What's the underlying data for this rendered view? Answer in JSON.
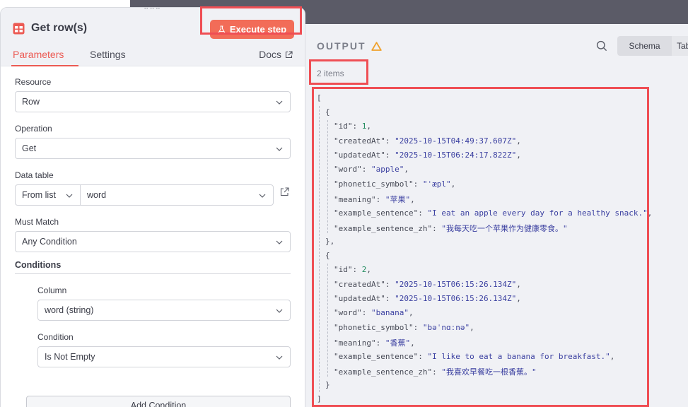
{
  "node": {
    "title": "Get row(s)",
    "execute_label": "Execute step",
    "tabs": [
      "Parameters",
      "Settings"
    ],
    "docs_label": "Docs"
  },
  "parameters": {
    "resource": {
      "label": "Resource",
      "value": "Row"
    },
    "operation": {
      "label": "Operation",
      "value": "Get"
    },
    "data_table": {
      "label": "Data table",
      "mode": "From list",
      "value": "word"
    },
    "must_match": {
      "label": "Must Match",
      "value": "Any Condition"
    },
    "conditions": {
      "heading": "Conditions",
      "column": {
        "label": "Column",
        "value": "word (string)"
      },
      "condition": {
        "label": "Condition",
        "value": "Is Not Empty"
      },
      "add_label": "Add Condition"
    }
  },
  "output": {
    "title": "OUTPUT",
    "items_count": "2 items",
    "view_tabs": [
      "Schema",
      "Table"
    ],
    "items": [
      {
        "id": "1",
        "createdAt": "\"2025-10-15T04:49:37.607Z\"",
        "updatedAt": "\"2025-10-15T06:24:17.822Z\"",
        "word": "\"apple\"",
        "phonetic_symbol": "\"ˈæpl\"",
        "meaning": "\"苹果\"",
        "example_sentence": "\"I eat an apple every day for a healthy snack.\"",
        "example_sentence_zh": "\"我每天吃一个苹果作为健康零食。\""
      },
      {
        "id": "2",
        "createdAt": "\"2025-10-15T06:15:26.134Z\"",
        "updatedAt": "\"2025-10-15T06:15:26.134Z\"",
        "word": "\"banana\"",
        "phonetic_symbol": "\"bəˈnɑːnə\"",
        "meaning": "\"香蕉\"",
        "example_sentence": "\"I like to eat a banana for breakfast.\"",
        "example_sentence_zh": "\"我喜欢早餐吃一根香蕉。\""
      }
    ]
  },
  "colors": {
    "accent": "#ec5a53",
    "execute_button": "#f26c58",
    "highlight": "#ef4e54",
    "warning": "#f0a12b"
  }
}
